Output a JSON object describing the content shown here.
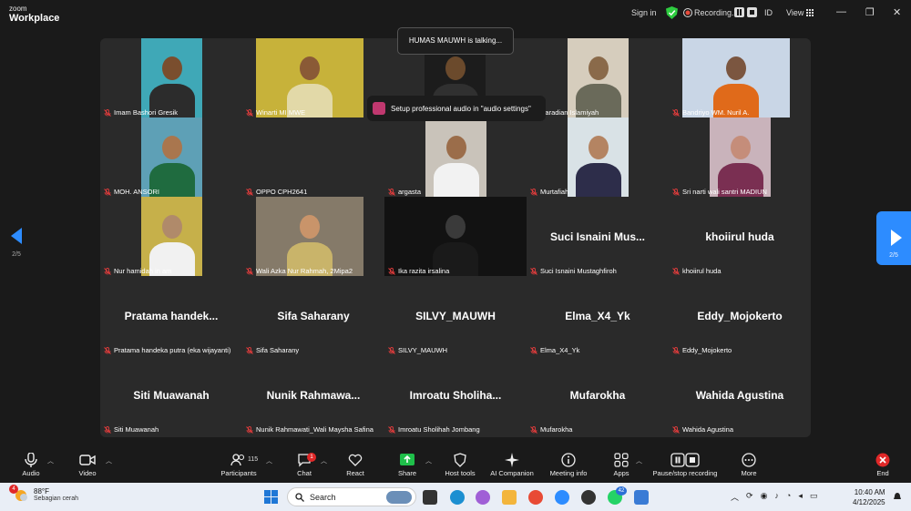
{
  "titlebar": {
    "brand_small": "zoom",
    "brand_large": "Workplace",
    "sign_in": "Sign in",
    "recording": "Recording...",
    "id": "ID",
    "view": "View"
  },
  "toasts": {
    "talking": "HUMAS MAUWH is talking...",
    "audio": "Setup professional audio in \"audio settings\""
  },
  "nav": {
    "left_page": "2/5",
    "right_page": "2/5"
  },
  "participants": [
    {
      "name": "Imam Bashori Gresik",
      "big": "",
      "photo": {
        "bg": "#3fa8b7",
        "skin": "#7a4e2e",
        "shirt": "#2c2c2c",
        "offset": 45
      }
    },
    {
      "name": "Winarti MI MWE",
      "big": "",
      "photo": {
        "bg": "#c7b23a",
        "skin": "#8a5a36",
        "shirt": "#e2d9a8",
        "offset": 15,
        "wide": true
      }
    },
    {
      "name": "",
      "big": "",
      "photo": {
        "bg": "#1c1c1c",
        "skin": "#6b4a2c",
        "shirt": "#303030",
        "offset": 44
      }
    },
    {
      "name": "Raradian Islamiyah",
      "big": "",
      "photo": {
        "bg": "#d6cdbd",
        "skin": "#8a6a4a",
        "shirt": "#6a6a5a",
        "offset": 45
      }
    },
    {
      "name": "Bandriyo WM. Nuril A.",
      "big": "",
      "photo": {
        "bg": "#c9d6e6",
        "skin": "#7b5640",
        "shirt": "#e06a1a",
        "offset": 15,
        "wide": true
      }
    },
    {
      "name": "MOH. ANSORI",
      "big": "",
      "photo": {
        "bg": "#5ea0b6",
        "skin": "#a9764e",
        "shirt": "#1f6b3f",
        "offset": 45
      }
    },
    {
      "name": "OPPO CPH2641",
      "big": "",
      "photo": null
    },
    {
      "name": "argasta",
      "big": "",
      "photo": {
        "bg": "#c9c3ba",
        "skin": "#9b6d4a",
        "shirt": "#f2f2f2",
        "offset": 45
      }
    },
    {
      "name": "Murtafiah",
      "big": "",
      "photo": {
        "bg": "#d9e2e6",
        "skin": "#b48462",
        "shirt": "#2d2d4a",
        "offset": 45
      }
    },
    {
      "name": "Sri narti wali santri MADIUN",
      "big": "",
      "photo": {
        "bg": "#c9b3bb",
        "skin": "#c58d7a",
        "shirt": "#7a2f52",
        "offset": 45
      }
    },
    {
      "name": "Nur hamidah in am",
      "big": "",
      "photo": {
        "bg": "#c6b04a",
        "skin": "#b08a6a",
        "shirt": "#f1f1f1",
        "offset": 45
      }
    },
    {
      "name": "Wali Azka Nur Rahmah, 2Mipa2",
      "big": "",
      "photo": {
        "bg": "#857a69",
        "skin": "#c9946a",
        "shirt": "#c9b46a",
        "offset": 15,
        "wide": true
      }
    },
    {
      "name": "Ika razita irsalina",
      "big": "",
      "photo": {
        "bg": "#121212",
        "skin": "#3a3a3a",
        "shirt": "#1a1a1a",
        "offset": 0,
        "full": true
      }
    },
    {
      "name": "Suci Isnaini Mustaghfiroh",
      "big": "Suci  Isnaini  Mus...",
      "photo": null
    },
    {
      "name": "khoiirul huda",
      "big": "khoiirul huda",
      "photo": null
    },
    {
      "name": "Pratama handeka putra (eka wijayanti)",
      "big": "Pratama  handek...",
      "photo": null
    },
    {
      "name": "Sifa Saharany",
      "big": "Sifa Saharany",
      "photo": null
    },
    {
      "name": "SILVY_MAUWH",
      "big": "SILVY_MAUWH",
      "photo": null
    },
    {
      "name": "Elma_X4_Yk",
      "big": "Elma_X4_Yk",
      "photo": null
    },
    {
      "name": "Eddy_Mojokerto",
      "big": "Eddy_Mojokerto",
      "photo": null
    },
    {
      "name": "Siti Muawanah",
      "big": "Siti Muawanah",
      "photo": null
    },
    {
      "name": "Nunik Rahmawati_Wali Maysha Safina",
      "big": "Nunik  Rahmawa...",
      "photo": null
    },
    {
      "name": "Imroatu Sholihah Jombang",
      "big": "Imroatu  Sholiha...",
      "photo": null
    },
    {
      "name": "Mufarokha",
      "big": "Mufarokha",
      "photo": null
    },
    {
      "name": "Wahida Agustina",
      "big": "Wahida Agustina",
      "photo": null
    }
  ],
  "toolbar": {
    "audio": "Audio",
    "video": "Video",
    "participants": "Participants",
    "participants_count": "115",
    "chat": "Chat",
    "chat_badge": "1",
    "react": "React",
    "share": "Share",
    "host_tools": "Host tools",
    "ai_companion": "AI Companion",
    "meeting_info": "Meeting info",
    "apps": "Apps",
    "pause_stop": "Pause/stop recording",
    "more": "More",
    "end": "End"
  },
  "taskbar": {
    "weather_badge": "4",
    "temperature": "88°F",
    "weather_desc": "Sebagian cerah",
    "search": "Search",
    "whatsapp_badge": "42",
    "time": "10:40 AM",
    "date": "4/12/2025"
  }
}
